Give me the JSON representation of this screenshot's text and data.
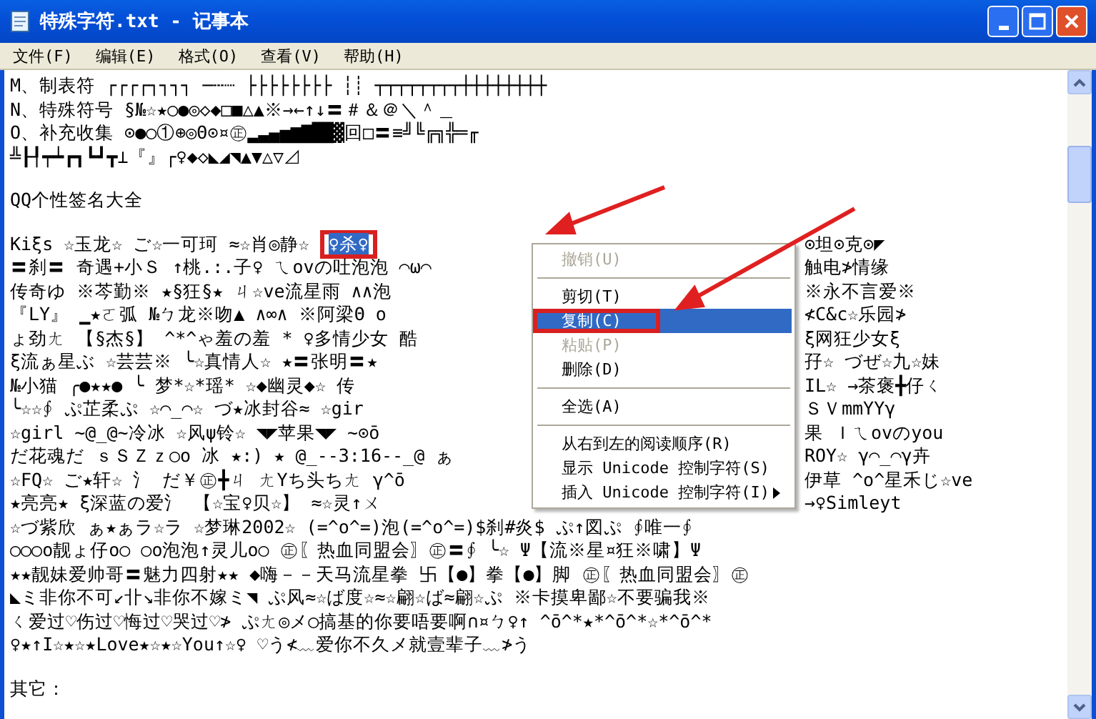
{
  "window": {
    "title": "特殊字符.txt - 记事本"
  },
  "menu_bar": [
    "文件(F)",
    "编辑(E)",
    "格式(O)",
    "查看(V)",
    "帮助(H)"
  ],
  "lines": [
    {
      "text": "M、制表符 ┌┌┌┌┐┐┐┐ ─┄┈ ├├├├├├├├ ┆┊ ┬┬┬┬┬┬┬┬┼┼┼┼┼┼┼┼"
    },
    {
      "text": "N、特殊符号 §№☆★○●◎◇◆□■△▲※→←↑↓〓＃＆＠＼＾＿"
    },
    {
      "text": "O、补充收集 ⊙●○①⊕◎Θ⊙¤㊣▂▃▄▅▆▇██▓回□〓≡╝╚╔╗╬═╓"
    },
    {
      "text": "╩┠┦┯┷┏┓┗┛┳⊥『』┌♀◆◇◣◢◥▲▼△▽⊿"
    },
    {
      "text": "QQ个性签名大全",
      "gap_before": true
    },
    {
      "gap_before": true,
      "text": "Kiξs ☆玉龙☆ ご☆一可珂 ≈☆肖◎静☆ ",
      "selection": "♀杀♀",
      "right": "⊙坦⊙克⊙◤"
    },
    {
      "text": "〓刹〓 奇遇+小Ｓ ↑桃.:.子♀ ㄟovの吐泡泡 ⌒ω⌒",
      "right": "触电≯情缘"
    },
    {
      "text": "传奇ゆ ※芩勤※ ★§狂§★ ㄐ☆ve流星雨 ∧∧泡",
      "right": "※永不言爱※"
    },
    {
      "text": "『LY』 ▁★ㄛ弧 №ㄅ龙※吻▲ ∧∞∧ ※阿梁Θ o",
      "right": "≮C&c☆乐园≯"
    },
    {
      "text": "ょ劲ㄤ 【§杰§】 ^*^ゃ羞の羞 * ♀多情少女 酷",
      "right": "ξ网狂少女ξ"
    },
    {
      "text": "ξ流ぁ星ぶ ☆芸芸※ ╰☆真情人☆ ★〓张明〓★",
      "right": "孖☆ づぜ☆九☆妹"
    },
    {
      "text": "№小猫 ╭●★★● ╰ 梦*☆*瑶* ☆◆幽灵◆☆ 传",
      "right": "IL☆ →茶褒╋仔ㄑ"
    },
    {
      "text": "╰☆☆∮ ぷ芷柔ぷ ☆⌒_⌒☆ づ★冰封谷≈ ☆gir",
      "right": "ＳＶmmΥΥγ"
    },
    {
      "text": "☆girl ~@_@~冷冰 ☆风ψ铃☆ ◥◤苹果◥◤ ~⊙ō",
      "right": "果 Ｉㄟovのyou"
    },
    {
      "text": "だ花魂だ ｓＳＺｚ○o 冰 ★:) ★ @_--3:16--_@ ぁ",
      "right": "ROY☆ γ⌒_⌒γ卉"
    },
    {
      "text": "☆FQ☆ ご★轩☆ 氵 だ￥㊣╋ㄐ ㄤΥち头ちㄤ γ^ō",
      "right": "伊草 ^o^星禾じ☆ve"
    },
    {
      "text": "★亮亮★ ξ深蓝の爱氵 【☆宝♀贝☆】 ≈☆灵↑ㄨ",
      "right": "→♀Simleyt"
    },
    {
      "text": "☆づ紫欣 ぁ★ぁラ☆ラ ☆梦琳2002☆ (=^o^=)泡(=^o^=)$刹#炎$ ぷ↑図ぷ ∮唯一∮"
    },
    {
      "text": "○○○o靓ょ仔o○ ○o泡泡↑灵儿o○ ㊣〖热血同盟会〗㊣〓∮ ╰☆ Ψ【流※星¤狂※啸】Ψ"
    },
    {
      "text": "★★靓妹爱帅哥〓魅力四射★★ ◆嗨－－天马流星拳 卐【●】拳【●】脚 ㊣〖热血同盟会〗㊣"
    },
    {
      "text": "◣ミ非你不可↙卝↘非你不嫁ミ◥ ぷ风≈☆ば度☆≈☆翩☆ば≈翩☆ぷ ※卡摸卑鄙☆不要骗我※"
    },
    {
      "text": "ㄑ爱过♡伤过♡悔过♡哭过♡≯ ぷㄤ◎メ○搞基的你要唔要啊∩¤ㄅ♀↑ ^ō^*★*^ō^*☆*^ō^*"
    },
    {
      "text": "♀★↑I☆★☆★Love★☆★☆You↑☆♀ ♡う≮﹏爱你不久メ就壹辈子﹏≯う"
    },
    {
      "text": "其它：",
      "gap_before": true
    }
  ],
  "context_menu": [
    {
      "kind": "item",
      "label": "撤销(U)",
      "disabled": true,
      "selected": false
    },
    {
      "kind": "separator"
    },
    {
      "kind": "item",
      "label": "剪切(T)",
      "disabled": false,
      "selected": false
    },
    {
      "kind": "item",
      "label": "复制(C)",
      "disabled": false,
      "selected": true
    },
    {
      "kind": "item",
      "label": "粘贴(P)",
      "disabled": true,
      "selected": false
    },
    {
      "kind": "item",
      "label": "删除(D)",
      "disabled": false,
      "selected": false
    },
    {
      "kind": "separator"
    },
    {
      "kind": "item",
      "label": "全选(A)",
      "disabled": false,
      "selected": false
    },
    {
      "kind": "separator"
    },
    {
      "kind": "item",
      "label": "从右到左的阅读顺序(R)",
      "disabled": false,
      "selected": false
    },
    {
      "kind": "item",
      "label": "显示 Unicode 控制字符(S)",
      "disabled": false,
      "selected": false
    },
    {
      "kind": "item",
      "label": "插入 Unicode 控制字符(I)",
      "disabled": false,
      "selected": false,
      "submenu": true
    }
  ]
}
